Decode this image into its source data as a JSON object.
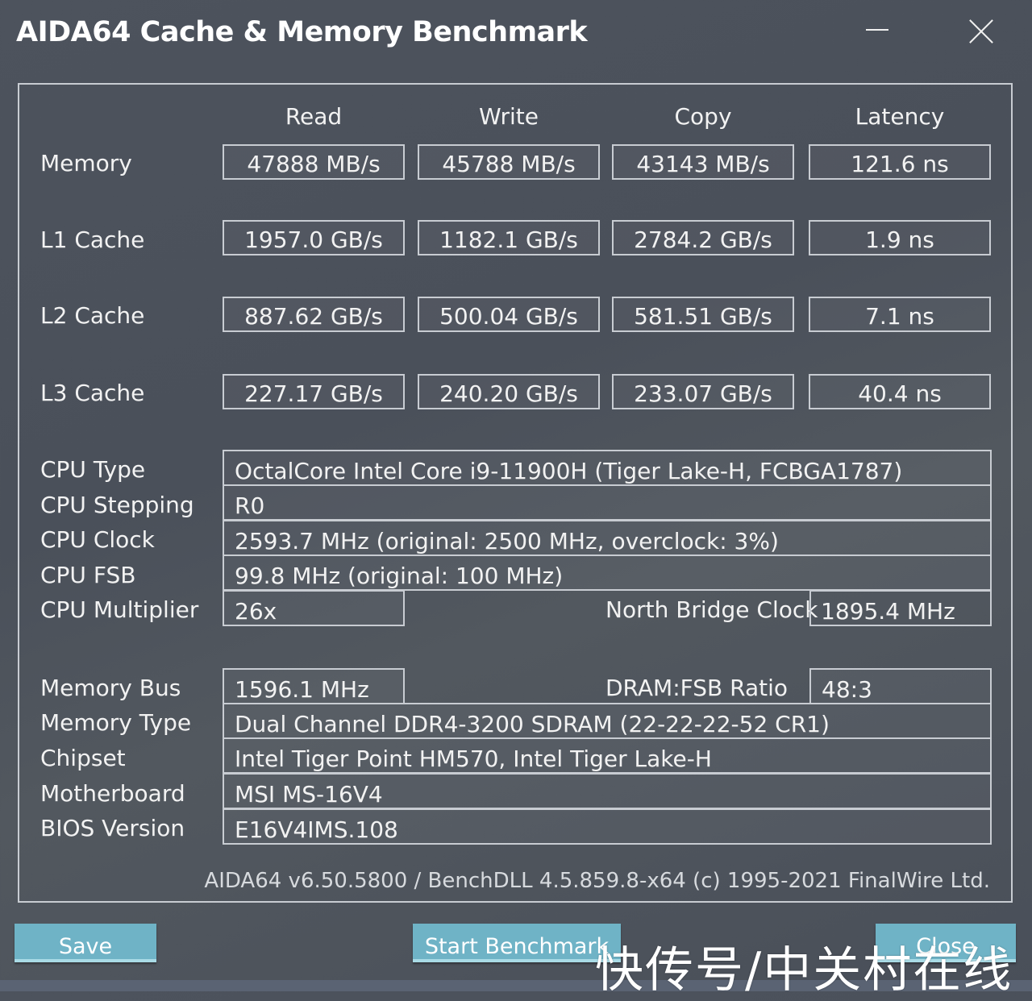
{
  "window": {
    "title": "AIDA64 Cache & Memory Benchmark",
    "minimize_icon": "minimize-icon",
    "close_icon": "close-icon"
  },
  "columns": [
    "Read",
    "Write",
    "Copy",
    "Latency"
  ],
  "benchmarks": [
    {
      "label": "Memory",
      "read": "47888 MB/s",
      "write": "45788 MB/s",
      "copy": "43143 MB/s",
      "latency": "121.6 ns"
    },
    {
      "label": "L1 Cache",
      "read": "1957.0 GB/s",
      "write": "1182.1 GB/s",
      "copy": "2784.2 GB/s",
      "latency": "1.9 ns"
    },
    {
      "label": "L2 Cache",
      "read": "887.62 GB/s",
      "write": "500.04 GB/s",
      "copy": "581.51 GB/s",
      "latency": "7.1 ns"
    },
    {
      "label": "L3 Cache",
      "read": "227.17 GB/s",
      "write": "240.20 GB/s",
      "copy": "233.07 GB/s",
      "latency": "40.4 ns"
    }
  ],
  "cpu": {
    "type_label": "CPU Type",
    "type_value": "OctalCore Intel Core i9-11900H  (Tiger Lake-H, FCBGA1787)",
    "stepping_label": "CPU Stepping",
    "stepping_value": "R0",
    "clock_label": "CPU Clock",
    "clock_value": "2593.7 MHz  (original: 2500 MHz, overclock: 3%)",
    "fsb_label": "CPU FSB",
    "fsb_value": "99.8 MHz  (original: 100 MHz)",
    "multiplier_label": "CPU Multiplier",
    "multiplier_value": "26x",
    "nb_clock_label": "North Bridge Clock",
    "nb_clock_value": "1895.4 MHz"
  },
  "memory": {
    "bus_label": "Memory Bus",
    "bus_value": "1596.1 MHz",
    "ratio_label": "DRAM:FSB Ratio",
    "ratio_value": "48:3",
    "type_label": "Memory Type",
    "type_value": "Dual Channel DDR4-3200 SDRAM  (22-22-22-52 CR1)",
    "chipset_label": "Chipset",
    "chipset_value": "Intel Tiger Point HM570, Intel Tiger Lake-H",
    "motherboard_label": "Motherboard",
    "motherboard_value": "MSI MS-16V4",
    "bios_label": "BIOS Version",
    "bios_value": "E16V4IMS.108"
  },
  "footer": "AIDA64 v6.50.5800 / BenchDLL 4.5.859.8-x64  (c) 1995-2021 FinalWire Ltd.",
  "buttons": {
    "save": "Save",
    "start": "Start Benchmark",
    "close": "Close"
  },
  "watermark": "快传号/中关村在线"
}
